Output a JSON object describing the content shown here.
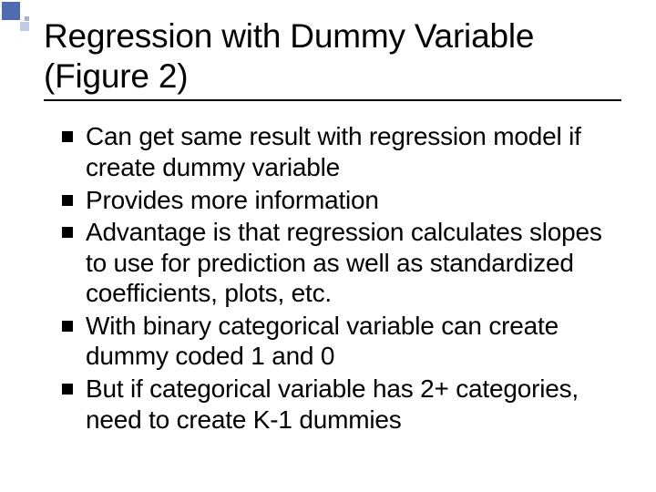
{
  "title": "Regression with Dummy Variable (Figure 2)",
  "bullets": {
    "b0": "Can get same result with regression model if create dummy variable",
    "b1": "Provides more information",
    "b2": "Advantage is that regression calculates slopes to use for prediction as well as standardized coefficients, plots, etc.",
    "b3": "With binary categorical variable can create dummy coded 1 and 0",
    "b4": "But if categorical variable has 2+ categories, need to create K-1 dummies"
  }
}
